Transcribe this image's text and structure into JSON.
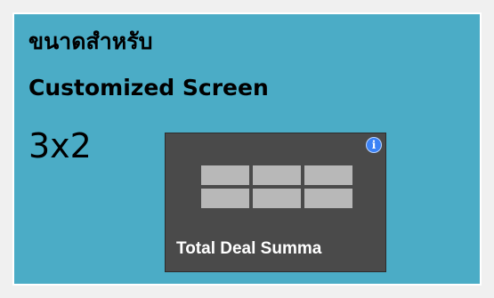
{
  "heading": {
    "thai": "ขนาดสำหรับ",
    "english": "Customized Screen"
  },
  "size_label": "3x2",
  "tile": {
    "title": "Total Deal Summa",
    "info_icon": "i",
    "grid": {
      "columns": 3,
      "rows": 2
    }
  },
  "colors": {
    "panel_background": "#4bacc6",
    "tile_background": "#4a4a4a",
    "grid_cell": "#b8b8b8",
    "info_icon": "#3b82f6"
  }
}
